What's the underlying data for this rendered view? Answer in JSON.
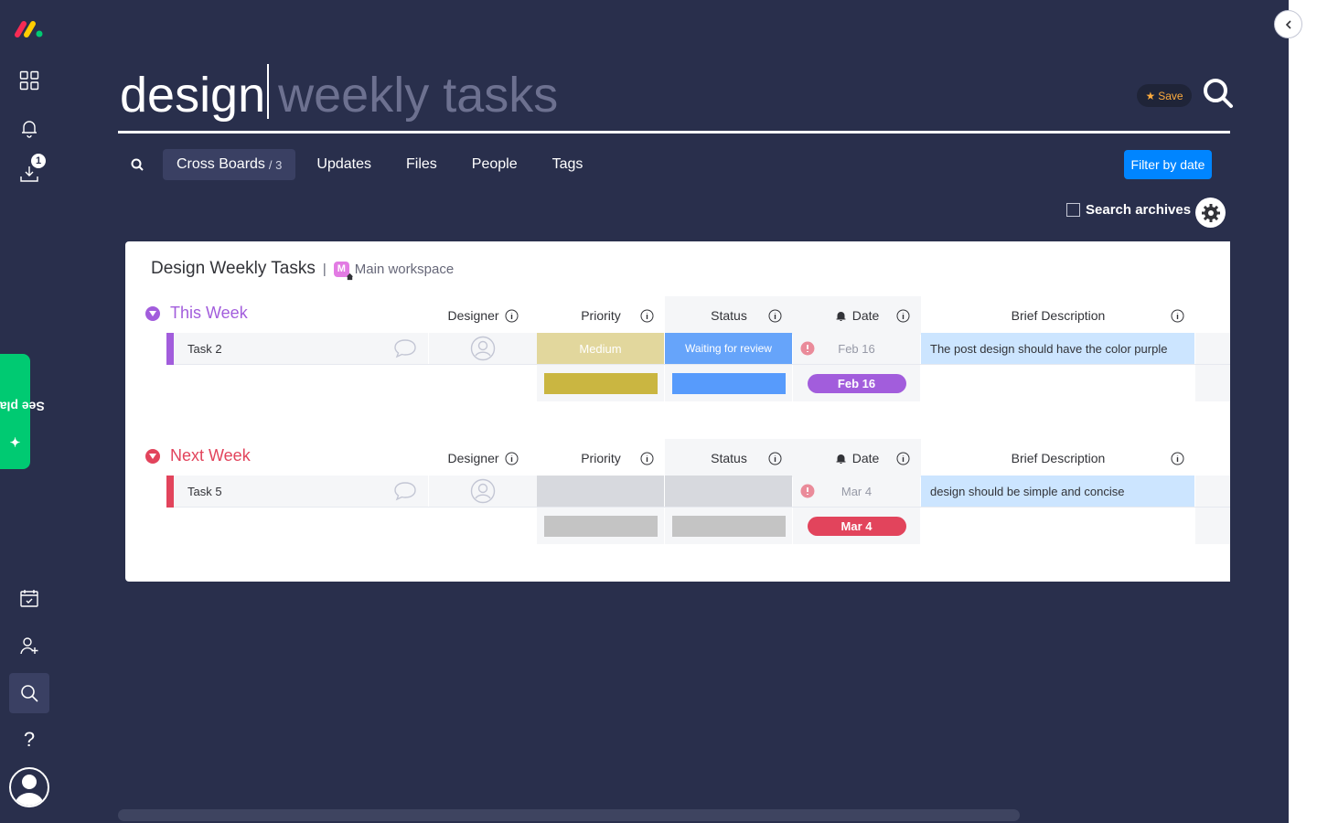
{
  "rail": {
    "download_badge": "1",
    "see_plans": "See plans"
  },
  "search": {
    "typed": "design",
    "suggestion": "weekly tasks",
    "save_label": "Save"
  },
  "tabs": [
    {
      "label": "Cross Boards",
      "count": "/ 3"
    },
    {
      "label": "Updates"
    },
    {
      "label": "Files"
    },
    {
      "label": "People"
    },
    {
      "label": "Tags"
    }
  ],
  "filter_label": "Filter by date",
  "archive_label": "Search archives",
  "board": {
    "title": "Design Weekly Tasks",
    "separator": "|",
    "workspace_initial": "M",
    "workspace": "Main workspace"
  },
  "columns": {
    "designer": "Designer",
    "priority": "Priority",
    "status": "Status",
    "date": "Date",
    "description": "Brief Description"
  },
  "groups": [
    {
      "title": "This Week",
      "color": "#a25ddc",
      "item": "Task 2",
      "priority": "Medium",
      "priority_color": "#e2d79d",
      "status": "Waiting for review",
      "status_color": "#66a4fa",
      "date": "Feb 16",
      "description": "The post design should have the color purple",
      "summary_priority_color": "#cab641",
      "summary_status_color": "#579bfc",
      "summary_date": "Feb 16",
      "summary_date_color": "#a25ddc"
    },
    {
      "title": "Next Week",
      "color": "#e2445c",
      "item": "Task 5",
      "priority": "",
      "priority_color": "#d7d9de",
      "status": "",
      "status_color": "#d7d9de",
      "date": "Mar 4",
      "description": "design should be simple and concise",
      "summary_priority_color": "#c4c4c4",
      "summary_status_color": "#c4c4c4",
      "summary_date": "Mar 4",
      "summary_date_color": "#e2445c"
    }
  ]
}
